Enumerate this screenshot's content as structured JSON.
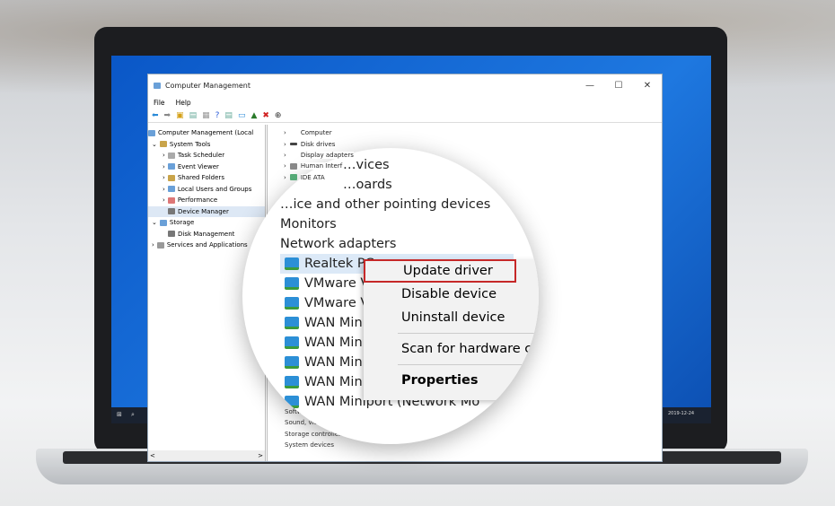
{
  "window": {
    "title": "Computer Management",
    "controls": [
      "—",
      "☐",
      "✕"
    ]
  },
  "menu": [
    "File",
    "Help"
  ],
  "toolbar_icons": [
    "back-arrow-icon",
    "forward-arrow-icon",
    "up-folder-icon",
    "show-tree-icon",
    "properties-icon",
    "help-icon",
    "console-icon",
    "monitor-icon",
    "update-driver-icon",
    "uninstall-icon",
    "scan-icon"
  ],
  "left_tree": [
    {
      "label": "Computer Management (Local",
      "indent": 0,
      "arrow": ""
    },
    {
      "label": "System Tools",
      "indent": 1,
      "arrow": "v"
    },
    {
      "label": "Task Scheduler",
      "indent": 2,
      "arrow": ">"
    },
    {
      "label": "Event Viewer",
      "indent": 2,
      "arrow": ">"
    },
    {
      "label": "Shared Folders",
      "indent": 2,
      "arrow": ">"
    },
    {
      "label": "Local Users and Groups",
      "indent": 2,
      "arrow": ">"
    },
    {
      "label": "Performance",
      "indent": 2,
      "arrow": ">"
    },
    {
      "label": "Device Manager",
      "indent": 2,
      "arrow": "",
      "selected": true
    },
    {
      "label": "Storage",
      "indent": 1,
      "arrow": "v"
    },
    {
      "label": "Disk Management",
      "indent": 2,
      "arrow": ""
    },
    {
      "label": "Services and Applications",
      "indent": 1,
      "arrow": ">"
    }
  ],
  "device_tree_top": [
    "Computer",
    "Disk drives",
    "Display adapters",
    "Human Interf",
    "IDE ATA"
  ],
  "device_tree_bottom": [
    "Softw",
    "Sound, video",
    "Storage controllers",
    "System devices"
  ],
  "magnified": {
    "rows": [
      "…vices",
      "…oards",
      "…ice and other pointing devices",
      "Monitors",
      "Network adapters"
    ],
    "adapters": [
      "Realtek PC",
      "VMware Vi",
      "VMware Vi",
      "WAN Minip",
      "WAN Minip",
      "WAN Minip",
      "WAN Minip",
      "WAN Miniport (Network Mo"
    ]
  },
  "context_menu": {
    "items": [
      "Update driver",
      "Disable device",
      "Uninstall device",
      "Scan for hardware c",
      "Properties"
    ],
    "highlighted": "Update driver",
    "highlight_color": "#c62828"
  },
  "scroll": {
    "left": "<",
    "right": ">"
  },
  "taskbar": {
    "search_icon": "⌕",
    "time": "2019-12-24"
  }
}
